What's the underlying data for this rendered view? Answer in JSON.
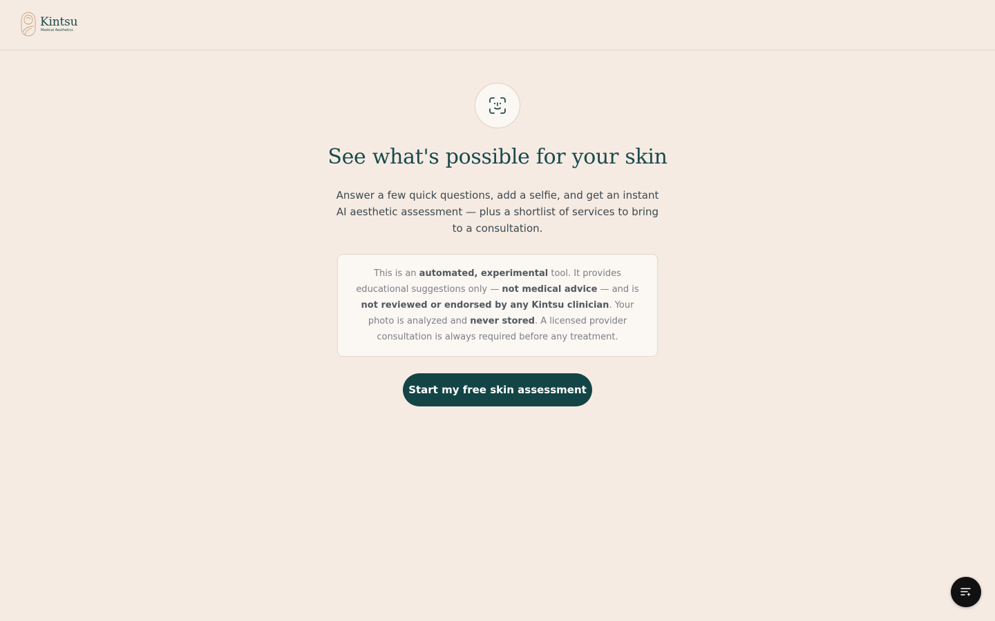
{
  "header": {
    "logo_name": "Kintsu",
    "logo_subtitle": "Medical Aesthetics"
  },
  "hero": {
    "icon": "face-scan-icon",
    "title": "See what's possible for your skin",
    "subtitle": "Answer a few quick questions, add a selfie, and get an instant AI aesthetic assessment — plus a shortlist of services to bring to a consultation."
  },
  "disclaimer": {
    "p1": "This is an ",
    "b1": "automated, experimental",
    "p2": " tool. It provides educational suggestions only — ",
    "b2": "not medical advice",
    "p3": " — and is ",
    "b3": "not reviewed or endorsed by any Kintsu clinician",
    "p4": ". Your photo is analyzed and ",
    "b4": "never stored",
    "p5": ". A licensed provider consultation is always required before any treatment."
  },
  "cta": {
    "label": "Start my free skin assessment"
  },
  "fab": {
    "icon": "list-sparkle-icon"
  },
  "colors": {
    "background": "#f5ebe3",
    "primary": "#134546",
    "accent_gold": "#c9a27a"
  }
}
